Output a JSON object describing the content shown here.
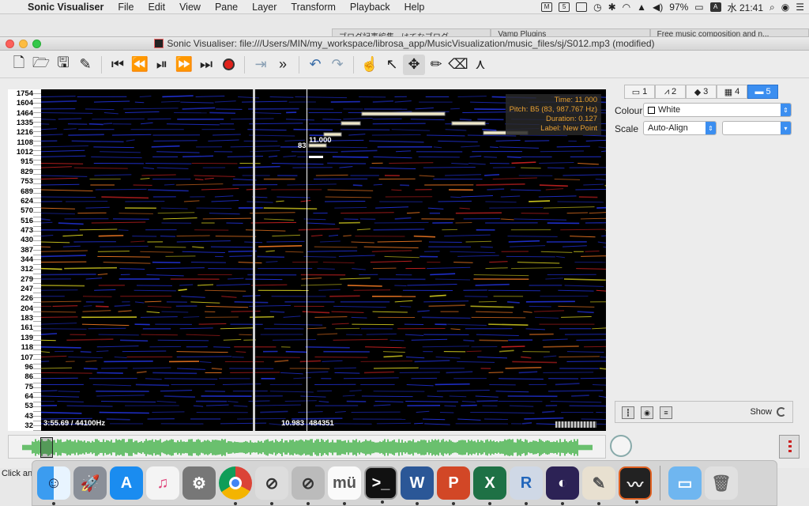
{
  "menubar": {
    "app_name": "Sonic Visualiser",
    "items": [
      "File",
      "Edit",
      "View",
      "Pane",
      "Layer",
      "Transform",
      "Playback",
      "Help"
    ],
    "battery": "97%",
    "ime": "A",
    "clock": "水 21:41"
  },
  "browser_tabs": [
    "ブログ記事編集 - はてなブログ",
    "Vamp Plugins",
    "Free music composition and n..."
  ],
  "window": {
    "title": "Sonic Visualiser: file:///Users/MIN/my_workspace/librosa_app/MusicVisualization/music_files/sj/S012.mp3 (modified)"
  },
  "toolbar": {
    "icons": [
      "new-file-icon",
      "open-folder-icon",
      "save-icon",
      "save-session-icon",
      "rewind-start-icon",
      "rewind-icon",
      "play-pause-icon",
      "fast-forward-icon",
      "forward-end-icon",
      "record-icon",
      "play-selection-icon",
      "more-icon",
      "undo-icon",
      "redo-icon",
      "navigate-hand-icon",
      "select-arrow-icon",
      "move-icon",
      "draw-pencil-icon",
      "erase-icon",
      "measure-icon"
    ]
  },
  "pane": {
    "scale_ticks": [
      "1754",
      "1604",
      "1464",
      "1335",
      "1216",
      "1108",
      "1012",
      "915",
      "829",
      "753",
      "689",
      "624",
      "570",
      "516",
      "473",
      "430",
      "387",
      "344",
      "312",
      "279",
      "247",
      "226",
      "204",
      "183",
      "161",
      "139",
      "118",
      "107",
      "96",
      "86",
      "75",
      "64",
      "53",
      "43",
      "32"
    ],
    "bottom_left": "3:55.69 / 44100Hz",
    "bottom_mid": "10.983",
    "bottom_frame": "484351",
    "note_label_pitch": "83",
    "note_label_time": "11.000",
    "info": {
      "time": "Time: 11.000",
      "pitch": "Pitch: B5 (83, 987.767 Hz)",
      "duration": "Duration: 0.127",
      "label": "Label: New Point"
    }
  },
  "properties": {
    "tabs": [
      "1",
      "2",
      "3",
      "4",
      "5"
    ],
    "selected_tab": "5",
    "colour_label": "Colour",
    "colour_value": "White",
    "scale_label": "Scale",
    "scale_value": "Auto-Align",
    "scale_value2": "",
    "show_label": "Show"
  },
  "status": {
    "text": "Click an"
  },
  "dock": {
    "apps": [
      "finder-icon",
      "launchpad-icon",
      "app-store-icon",
      "itunes-icon",
      "system-preferences-icon",
      "chrome-icon",
      "no-entry-icon",
      "no-entry-2-icon",
      "mu-icon",
      "terminal-icon",
      "word-icon",
      "powerpoint-icon",
      "excel-icon",
      "r-icon",
      "eclipse-icon",
      "preview-icon",
      "sonic-visualiser-icon",
      "folder-icon",
      "trash-icon"
    ]
  },
  "colors": {
    "accent": "#3b8ef0",
    "record": "#e0221b",
    "waveform": "#3db043",
    "info_text": "#e8a030"
  }
}
